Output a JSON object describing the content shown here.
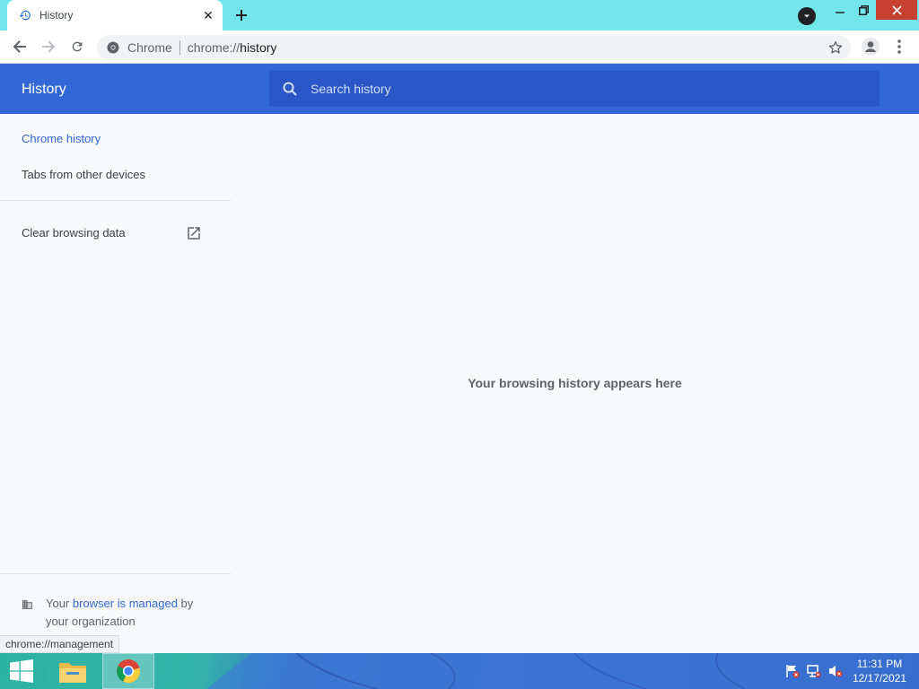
{
  "tab": {
    "title": "History",
    "favicon": "history-icon"
  },
  "omnibox": {
    "chip": "Chrome",
    "url_host": "chrome://",
    "url_path": "history"
  },
  "header": {
    "title": "History",
    "search_placeholder": "Search history"
  },
  "sidebar": {
    "items": [
      {
        "label": "Chrome history",
        "selected": true
      },
      {
        "label": "Tabs from other devices",
        "selected": false
      },
      {
        "label": "Clear browsing data",
        "selected": false
      }
    ],
    "managed": {
      "prefix": "Your ",
      "link": "browser is managed",
      "suffix": " by your organization"
    }
  },
  "main": {
    "empty_message": "Your browsing history appears here"
  },
  "status_bubble": "chrome://management",
  "taskbar": {
    "apps": [
      "file-explorer-icon",
      "chrome-icon"
    ],
    "clock_time": "11:31 PM",
    "clock_date": "12/17/2021"
  },
  "colors": {
    "accent": "#3367d6",
    "tabstrip": "#72e5ea",
    "close_button": "#c84031"
  }
}
